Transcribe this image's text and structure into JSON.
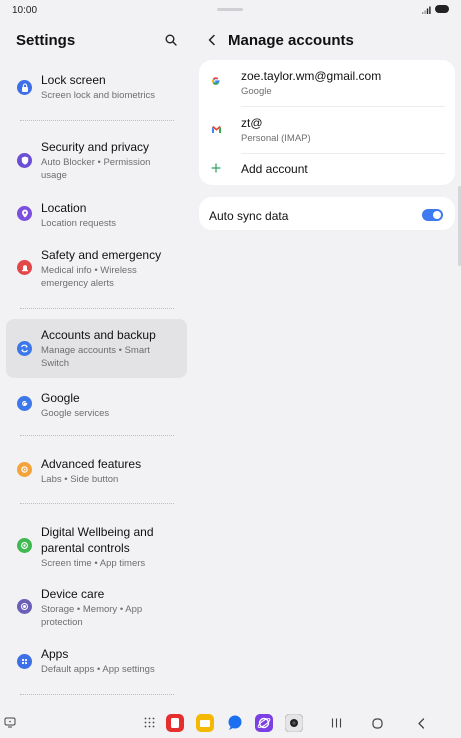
{
  "status_bar": {
    "time": "10:00"
  },
  "settings": {
    "title": "Settings",
    "items": [
      {
        "title": "Lock screen",
        "subtitle": "Screen lock and biometrics",
        "icon": "lock-icon",
        "color": "#3d6fe6"
      },
      {
        "title": "Security and privacy",
        "subtitle": "Auto Blocker • Permission usage",
        "icon": "shield-icon",
        "color": "#6a4fd6"
      },
      {
        "title": "Location",
        "subtitle": "Location requests",
        "icon": "location-pin-icon",
        "color": "#7c4fe0"
      },
      {
        "title": "Safety and emergency",
        "subtitle": "Medical info • Wireless emergency alerts",
        "icon": "emergency-icon",
        "color": "#e0484a"
      },
      {
        "title": "Accounts and backup",
        "subtitle": "Manage accounts • Smart Switch",
        "icon": "sync-icon",
        "color": "#3d78ea"
      },
      {
        "title": "Google",
        "subtitle": "Google services",
        "icon": "google-icon",
        "color": "#3d78ea"
      },
      {
        "title": "Advanced features",
        "subtitle": "Labs • Side button",
        "icon": "star-gear-icon",
        "color": "#f2a33a"
      },
      {
        "title": "Digital Wellbeing and parental controls",
        "subtitle": "Screen time • App timers",
        "icon": "wellbeing-icon",
        "color": "#3fb950"
      },
      {
        "title": "Device care",
        "subtitle": "Storage • Memory • App protection",
        "icon": "device-care-icon",
        "color": "#6b5fb8"
      },
      {
        "title": "Apps",
        "subtitle": "Default apps • App settings",
        "icon": "apps-grid-icon",
        "color": "#3d6fe6"
      }
    ]
  },
  "manage_accounts": {
    "title": "Manage accounts",
    "accounts": [
      {
        "name": "zoe.taylor.wm@gmail.com",
        "type": "Google",
        "icon": "google-g-icon"
      },
      {
        "name": "zt@",
        "type": "Personal (IMAP)",
        "icon": "gmail-icon"
      }
    ],
    "add_account_label": "Add account",
    "auto_sync": {
      "label": "Auto sync data",
      "enabled": true
    }
  },
  "colors": {
    "accent": "#3e7bf0",
    "background": "#f2f2f4"
  }
}
